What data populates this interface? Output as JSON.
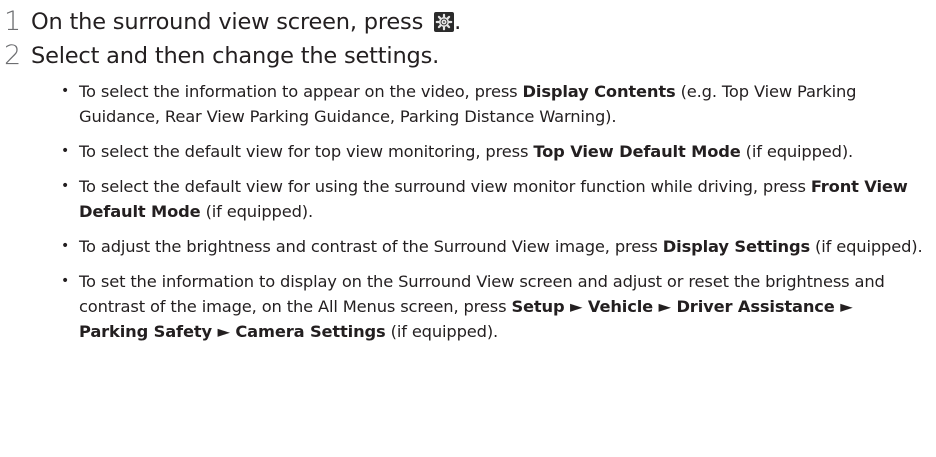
{
  "steps": [
    {
      "number": "1",
      "text_before": "On the surround view screen, press",
      "text_after": "."
    },
    {
      "number": "2",
      "text": "Select and then change the settings."
    }
  ],
  "icons": {
    "settings": "gear-icon"
  },
  "bullets": [
    {
      "pre": "To select the information to appear on the video, press ",
      "bold1": "Display Contents",
      "post": " (e.g. Top View Parking Guidance, Rear View Parking Guidance, Parking Distance Warning)."
    },
    {
      "pre": "To select the default view for top view monitoring, press ",
      "bold1": "Top View Default Mode",
      "post": " (if equipped)."
    },
    {
      "pre": "To select the default view for using the surround view monitor function while driving, press ",
      "bold1": "Front View Default Mode",
      "post": " (if equipped)."
    },
    {
      "pre": "To adjust the brightness and contrast of the Surround View image, press ",
      "bold1": "Display Settings",
      "post": " (if equipped)."
    },
    {
      "pre": "To set the information to display on the Surround View screen and adjust or reset the brightness and contrast of the image, on the All Menus screen, press ",
      "bold1": "Setup ► Vehicle ► Driver Assistance ► Parking Safety ► Camera Settings",
      "post": " (if equipped)."
    }
  ]
}
